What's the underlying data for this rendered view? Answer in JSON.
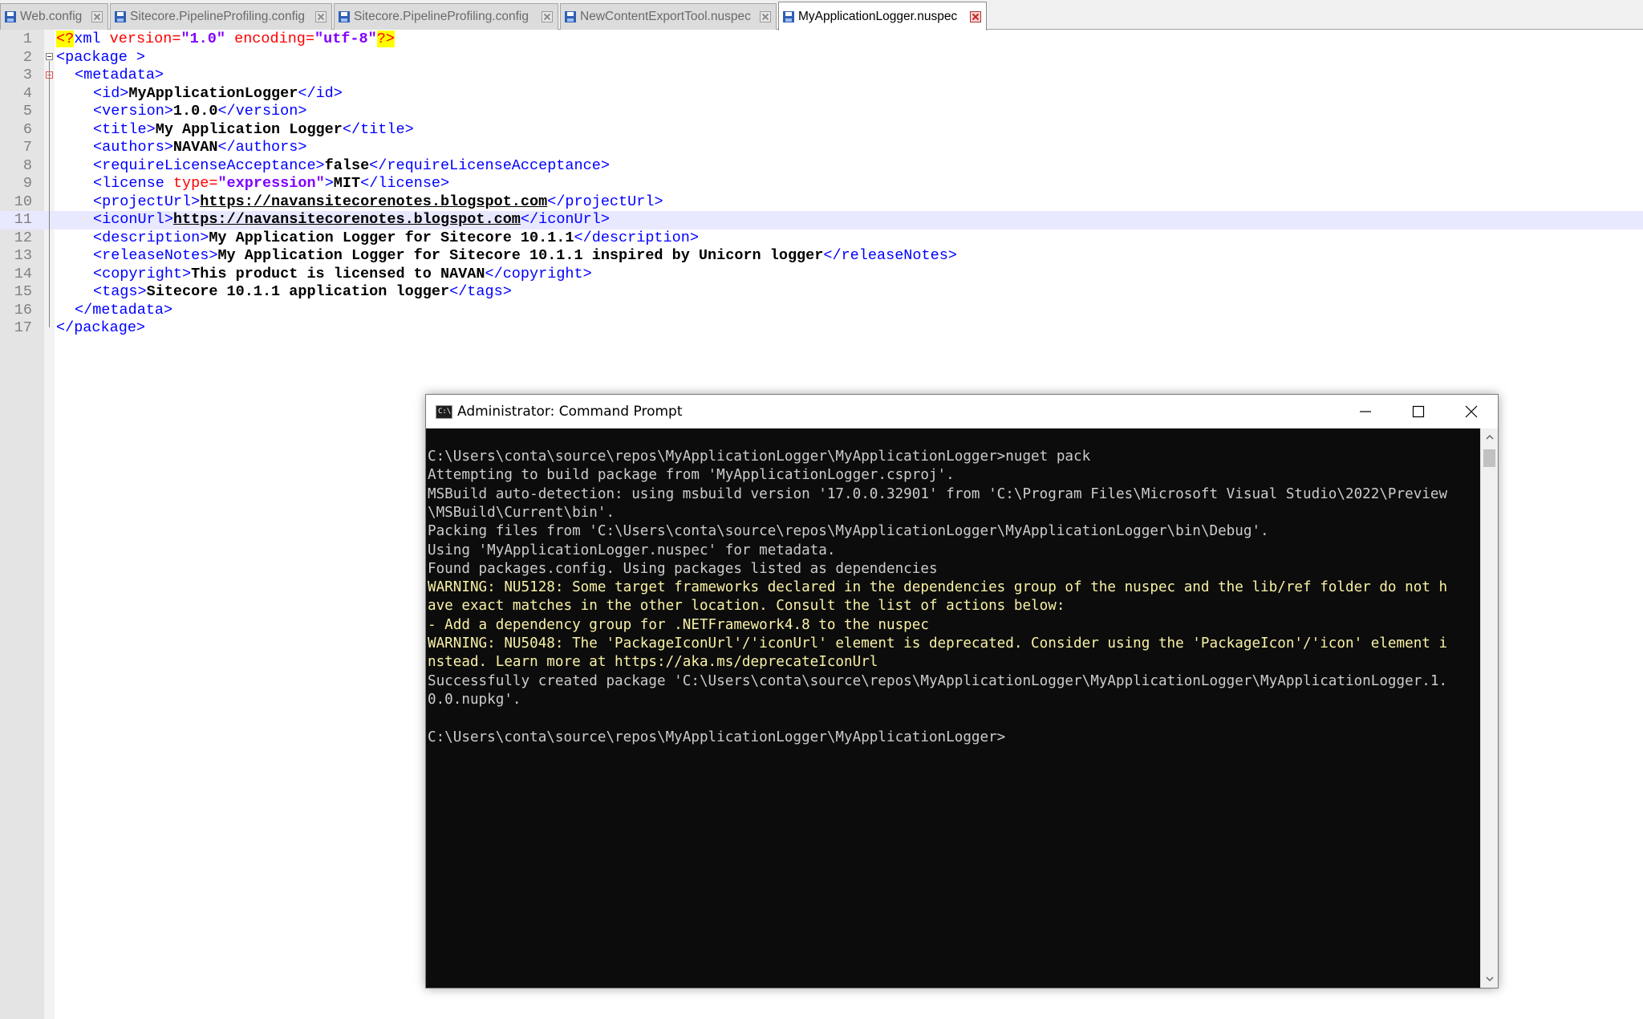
{
  "tabs": [
    {
      "label": "Web.config",
      "active": false
    },
    {
      "label": "Sitecore.PipelineProfiling.config",
      "active": false
    },
    {
      "label": "Sitecore.PipelineProfiling.config",
      "active": false
    },
    {
      "label": "NewContentExportTool.nuspec",
      "active": false
    },
    {
      "label": "MyApplicationLogger.nuspec",
      "active": true
    }
  ],
  "editor": {
    "current_line": 11,
    "lines": [
      {
        "n": "1"
      },
      {
        "n": "2"
      },
      {
        "n": "3"
      },
      {
        "n": "4"
      },
      {
        "n": "5"
      },
      {
        "n": "6"
      },
      {
        "n": "7"
      },
      {
        "n": "8"
      },
      {
        "n": "9"
      },
      {
        "n": "10"
      },
      {
        "n": "11"
      },
      {
        "n": "12"
      },
      {
        "n": "13"
      },
      {
        "n": "14"
      },
      {
        "n": "15"
      },
      {
        "n": "16"
      },
      {
        "n": "17"
      }
    ],
    "xml": {
      "pi_open": "<?",
      "pi_name": "xml",
      "pi_version_attr": "version=",
      "pi_version_val": "\"1.0\"",
      "pi_encoding_attr": "encoding=",
      "pi_encoding_val": "\"utf-8\"",
      "pi_close": "?>",
      "package_open": "<package >",
      "metadata_open": "<metadata>",
      "id_open": "<id>",
      "id_value": "MyApplicationLogger",
      "id_close": "</id>",
      "version_open": "<version>",
      "version_value": "1.0.0",
      "version_close": "</version>",
      "title_open": "<title>",
      "title_value": "My Application Logger",
      "title_close": "</title>",
      "authors_open": "<authors>",
      "authors_value": "NAVAN",
      "authors_close": "</authors>",
      "rla_open": "<requireLicenseAcceptance>",
      "rla_value": "false",
      "rla_close": "</requireLicenseAcceptance>",
      "license_open_start": "<license",
      "license_attr": "type=",
      "license_attr_val": "\"expression\"",
      "license_open_end": ">",
      "license_value": "MIT",
      "license_close": "</license>",
      "projecturl_open": "<projectUrl>",
      "projecturl_value": "https://navansitecorenotes.blogspot.com",
      "projecturl_close": "</projectUrl>",
      "iconurl_open": "<iconUrl>",
      "iconurl_value": "https://navansitecorenotes.blogspot.com",
      "iconurl_close": "</iconUrl>",
      "description_open": "<description>",
      "description_value": "My Application Logger for Sitecore 10.1.1",
      "description_close": "</description>",
      "releasenotes_open": "<releaseNotes>",
      "releasenotes_value": "My Application Logger for Sitecore 10.1.1 inspired by Unicorn logger",
      "releasenotes_close": "</releaseNotes>",
      "copyright_open": "<copyright>",
      "copyright_value": "This product is licensed to NAVAN",
      "copyright_close": "</copyright>",
      "tags_open": "<tags>",
      "tags_value": "Sitecore 10.1.1 application logger",
      "tags_close": "</tags>",
      "metadata_close": "</metadata>",
      "package_close": "</package>"
    }
  },
  "cmd": {
    "title": "Administrator: Command Prompt",
    "icon_text": "C:\\",
    "lines": [
      {
        "text": "C:\\Users\\conta\\source\\repos\\MyApplicationLogger\\MyApplicationLogger>nuget pack",
        "kind": "normal"
      },
      {
        "text": "Attempting to build package from 'MyApplicationLogger.csproj'.",
        "kind": "normal"
      },
      {
        "text": "MSBuild auto-detection: using msbuild version '17.0.0.32901' from 'C:\\Program Files\\Microsoft Visual Studio\\2022\\Preview",
        "kind": "normal"
      },
      {
        "text": "\\MSBuild\\Current\\bin'.",
        "kind": "normal"
      },
      {
        "text": "Packing files from 'C:\\Users\\conta\\source\\repos\\MyApplicationLogger\\MyApplicationLogger\\bin\\Debug'.",
        "kind": "normal"
      },
      {
        "text": "Using 'MyApplicationLogger.nuspec' for metadata.",
        "kind": "normal"
      },
      {
        "text": "Found packages.config. Using packages listed as dependencies",
        "kind": "normal"
      },
      {
        "text": "WARNING: NU5128: Some target frameworks declared in the dependencies group of the nuspec and the lib/ref folder do not h",
        "kind": "warn"
      },
      {
        "text": "ave exact matches in the other location. Consult the list of actions below:",
        "kind": "warn"
      },
      {
        "text": "- Add a dependency group for .NETFramework4.8 to the nuspec",
        "kind": "warn"
      },
      {
        "text": "WARNING: NU5048: The 'PackageIconUrl'/'iconUrl' element is deprecated. Consider using the 'PackageIcon'/'icon' element i",
        "kind": "warn"
      },
      {
        "text": "nstead. Learn more at https://aka.ms/deprecateIconUrl",
        "kind": "warn"
      },
      {
        "text": "Successfully created package 'C:\\Users\\conta\\source\\repos\\MyApplicationLogger\\MyApplicationLogger\\MyApplicationLogger.1.",
        "kind": "normal"
      },
      {
        "text": "0.0.nupkg'.",
        "kind": "normal"
      },
      {
        "text": "",
        "kind": "normal"
      },
      {
        "text": "C:\\Users\\conta\\source\\repos\\MyApplicationLogger\\MyApplicationLogger>",
        "kind": "normal"
      }
    ]
  },
  "colors": {
    "xml_tag": "#0000ff",
    "xml_attr": "#ff0000",
    "xml_attr_value": "#8000ff",
    "pi_highlight": "#ffff00",
    "current_line": "#e8e8ff",
    "console_bg": "#0c0c0c",
    "console_text": "#cccccc",
    "console_warning": "#f9f1a5"
  }
}
